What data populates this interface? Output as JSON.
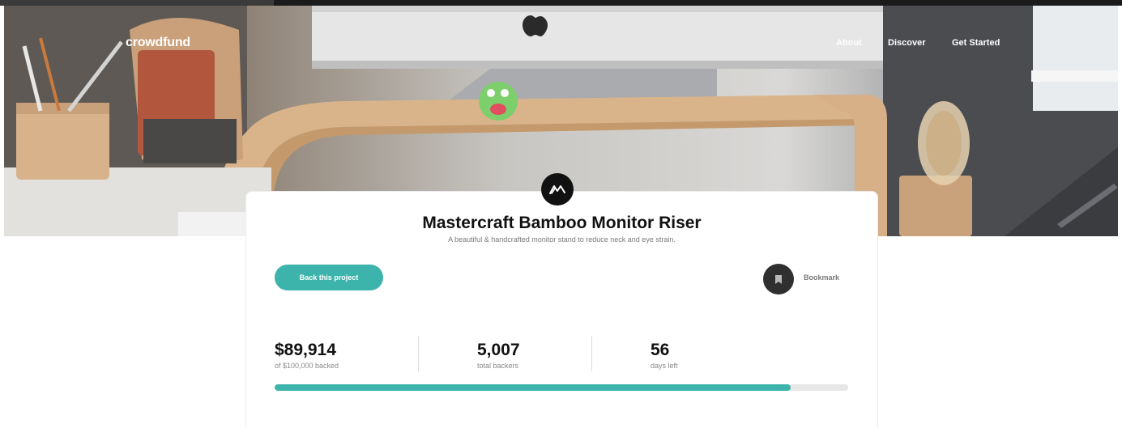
{
  "header": {
    "logo": "crowdfund",
    "nav": [
      "About",
      "Discover",
      "Get Started"
    ]
  },
  "project": {
    "brand_icon": "mastercraft-logo-icon",
    "title": "Mastercraft Bamboo Monitor Riser",
    "subtitle": "A beautiful & handcrafted monitor stand to reduce neck and eye strain.",
    "back_label": "Back this project",
    "bookmark_label": "Bookmark",
    "bookmark_icon": "bookmark-icon"
  },
  "stats": {
    "backed_amount": "$89,914",
    "backed_label": "of $100,000 backed",
    "backers": "5,007",
    "backers_label": "total backers",
    "days": "56",
    "days_label": "days left",
    "progress_fraction": 0.89914
  },
  "colors": {
    "accent": "#3cb3ab",
    "dark": "#2f2f2f"
  }
}
